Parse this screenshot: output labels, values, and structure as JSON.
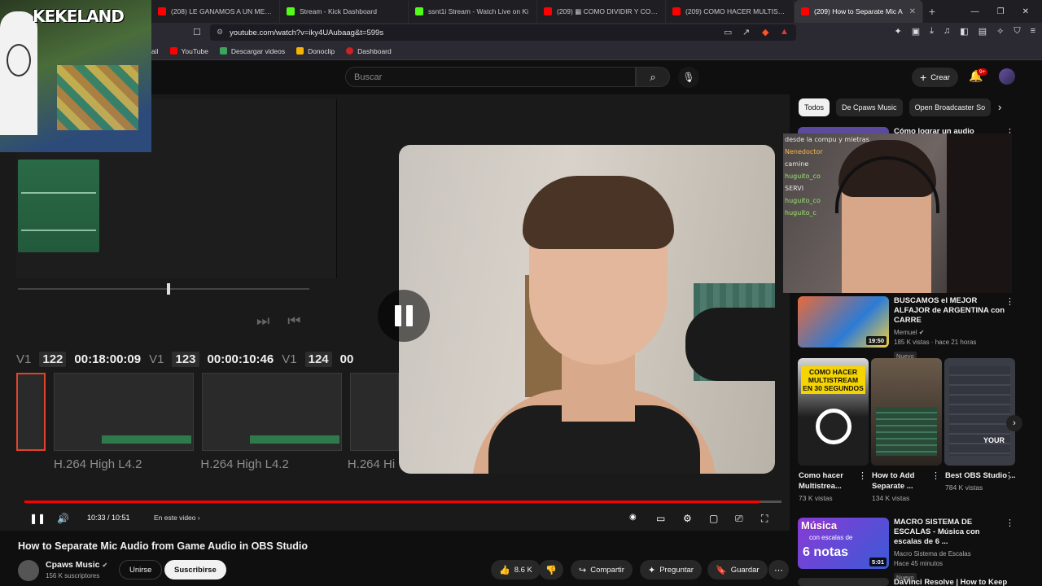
{
  "browser": {
    "tabs": [
      {
        "label": "(208) LE GANAMOS A UN MERIENDE",
        "color": "#ff0000"
      },
      {
        "label": "Stream - Kick Dashboard",
        "color": "#53fc18"
      },
      {
        "label": "ssnt1i Stream - Watch Live on Ki",
        "color": "#53fc18"
      },
      {
        "label": "(209) ▦ COMO DIVIDIR Y CONT",
        "color": "#ff0000"
      },
      {
        "label": "(209) COMO HACER MULTISTREAM",
        "color": "#ff0000"
      },
      {
        "label": "(209) How to Separate Mic A",
        "color": "#ff0000",
        "active": true
      }
    ],
    "url": "youtube.com/watch?v=iky4UAubaag&t=599s",
    "bookmarks": [
      {
        "label": "ail",
        "color": "#888888"
      },
      {
        "label": "YouTube",
        "color": "#ff0000"
      },
      {
        "label": "Descargar videos",
        "color": "#3ba55c"
      },
      {
        "label": "Donoclip",
        "color": "#f4b400"
      },
      {
        "label": "Dashboard",
        "color": "#cc2222"
      }
    ]
  },
  "header": {
    "search_placeholder": "Buscar",
    "create_label": "Crear",
    "notif_badge": "9+"
  },
  "player": {
    "editor": {
      "clips": [
        {
          "track": "V1",
          "num": "122",
          "tc": "00:18:00:09"
        },
        {
          "track": "V1",
          "num": "123",
          "tc": "00:00:10:46"
        },
        {
          "track": "V1",
          "num": "124",
          "tc": "00"
        }
      ],
      "codecs": [
        "H.264 High L4.2",
        "H.264 High L4.2",
        "H.264 Hi"
      ]
    },
    "time": "10:33 / 10:51",
    "progress": 0.972,
    "chapter": "En este video",
    "accent": "#ff0000"
  },
  "overlay": {
    "logo": "KEKELAND"
  },
  "stream_chat": [
    "desde la compu y mietras",
    "Nenedoctor",
    "camine",
    "huguito_co",
    "SERVI",
    "huguito_co",
    "huguito_c"
  ],
  "chips": [
    "Todos",
    "De Cpaws Music",
    "Open Broadcaster So"
  ],
  "recs": [
    {
      "title": "Cómo lograr un audio",
      "meta1": "",
      "meta2": "",
      "duration": "",
      "badge": ""
    },
    {
      "title": "BUSCAMOS el MEJOR ALFAJOR de ARGENTINA con CARRE",
      "channel": "Memuel",
      "stats": "185 K vistas · hace 21 horas",
      "duration": "19:50",
      "badge": "Nuevo"
    },
    {
      "title": "MACRO SISTEMA DE ESCALAS - Música con escalas de 6 ...",
      "channel": "Macro Sistema de Escalas",
      "stats": "Hace 45 minutos",
      "duration": "5:01",
      "badge": "Nuevo",
      "thumb_text1": "Música",
      "thumb_text2": "con escalas de",
      "thumb_text3": "6 notas"
    },
    {
      "title": "DaVinci Resolve | How to Keep"
    }
  ],
  "shorts": [
    {
      "title": "Como hacer Multistrea...",
      "views": "73 K vistas",
      "thumb_text": "COMO HACER MULTISTREAM EN 30 SEGUNDOS"
    },
    {
      "title": "How to Add Separate ...",
      "views": "134 K vistas"
    },
    {
      "title": "Best OBS Studio ...",
      "views": "784 K vistas",
      "thumb_text": "YOUR"
    }
  ],
  "video": {
    "title": "How to Separate Mic Audio from Game Audio in OBS Studio",
    "channel": "Cpaws Music",
    "subs": "156 K suscriptores",
    "join": "Unirse",
    "subscribe": "Suscribirse",
    "likes": "8.6 K",
    "share": "Compartir",
    "ask": "Preguntar",
    "save": "Guardar"
  }
}
